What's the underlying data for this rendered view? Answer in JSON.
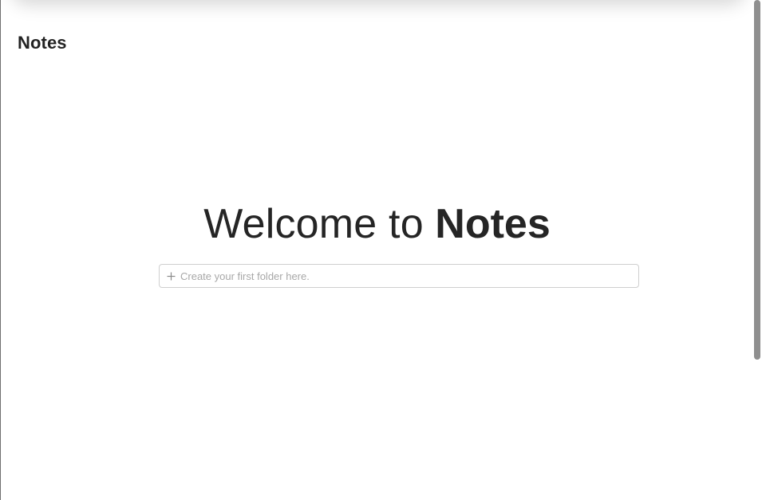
{
  "app": {
    "title": "Notes"
  },
  "welcome": {
    "prefix": "Welcome to",
    "app_name": "Notes"
  },
  "new_folder": {
    "placeholder": "Create your first folder here.",
    "value": "",
    "icon": "plus-icon"
  },
  "colors": {
    "text": "#232323",
    "input_border": "#cfcfcf",
    "placeholder": "#a8a8a8",
    "scrollbar_thumb": "#8f8f8f"
  }
}
